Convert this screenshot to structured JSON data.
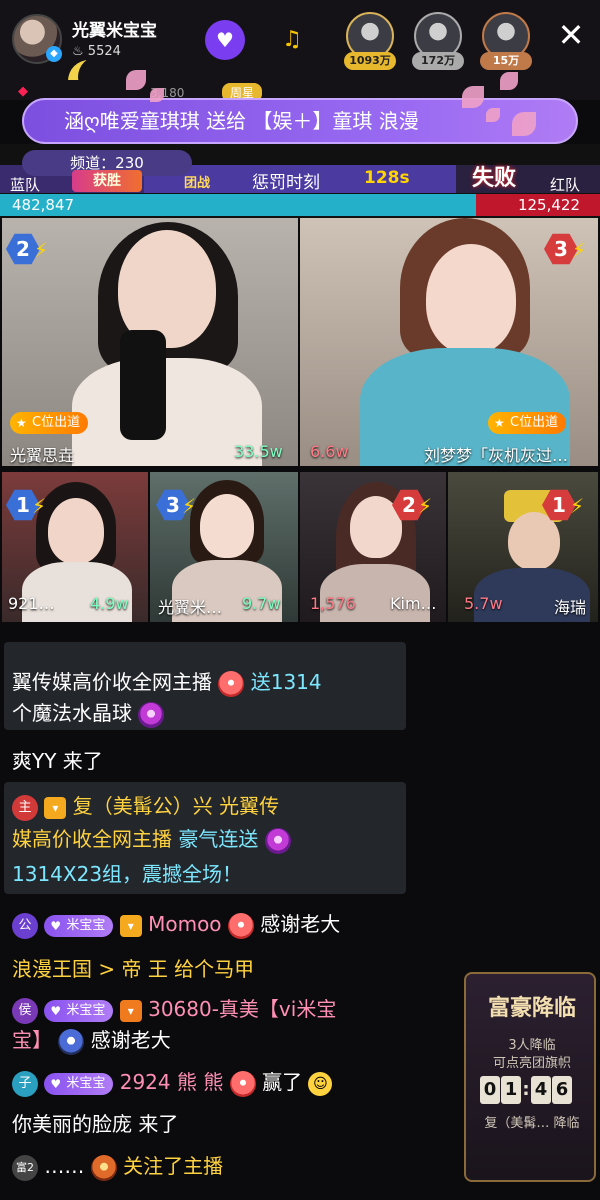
{
  "header": {
    "host_name": "光翼米宝宝",
    "host_fans": "5524",
    "viewers": [
      {
        "count": "1093万"
      },
      {
        "count": "172万"
      },
      {
        "count": "15万"
      }
    ]
  },
  "info": {
    "rank_value": "3,180",
    "tag": "周星"
  },
  "gift_banner": {
    "text": "涵ღ唯爱童琪琪 送给 【娱＋】童琪 浪漫"
  },
  "channel": "频道：230",
  "pk": {
    "blue_label": "蓝队",
    "red_label": "红队",
    "win_badge": "获胜",
    "fail_badge": "失败",
    "punish_icon": "团战",
    "punish_text": "惩罚时刻",
    "timer": "128s",
    "blue_score": "482,847",
    "red_score": "125,422",
    "blue_score_num": 482847,
    "red_score_num": 125422
  },
  "tiles_top": [
    {
      "rank": "2",
      "cpos": "C位出道",
      "name": "光翼思垚",
      "score": "33.5w"
    },
    {
      "rank": "3",
      "cpos": "C位出道",
      "name": "刘梦梦「灰机灰过…",
      "score": "6.6w"
    }
  ],
  "tiles_bottom": [
    {
      "rank": "1",
      "name": "921…",
      "score": "4.9w"
    },
    {
      "rank": "3",
      "name": "光翼米…",
      "score": "9.7w"
    },
    {
      "rank": "2",
      "name": "Kim…",
      "score": "1,576"
    },
    {
      "rank": "1",
      "name": "海瑞",
      "score": "5.7w"
    }
  ],
  "chat": {
    "msg1_line1": "翼传媒高价收全网主播",
    "msg1_send": "送1314",
    "msg1_line2": "个魔法水晶球",
    "msg2": "爽YY 来了",
    "msg3_user": "复（美髯公）兴 光翼传",
    "msg3_line2a": "媒高价收全网主播",
    "msg3_action": "豪气连送",
    "msg3_line3": "1314X23组，震撼全场！",
    "msg4_level": "公",
    "msg4_vip": "米宝宝",
    "msg4_user": "Momoo",
    "msg4_text": "感谢老大",
    "msg5_text": "浪漫王国 >  帝 王 给个马甲",
    "msg6_level": "侯",
    "msg6_vip": "米宝宝",
    "msg6_user_a": "30680-真美【vi米宝",
    "msg6_user_b": "宝】",
    "msg6_text": "感谢老大",
    "msg7_level": "子",
    "msg7_vip": "米宝宝",
    "msg7_user": "2924 熊 熊",
    "msg7_text": "赢了",
    "msg8": "你美丽的脸庞 来了",
    "msg9_level": "富2",
    "msg9_user": "……",
    "msg9_text": "关注了主播",
    "msg_rank_prefix": "主"
  },
  "rich_panel": {
    "title": "富豪降临",
    "line1": "3人降临",
    "line2": "可点亮团旗帜",
    "timer": [
      "0",
      "1",
      ":",
      "4",
      "6"
    ],
    "footer": "复（美髯… 降临"
  },
  "colors": {
    "accent_purple": "#7a3ef0",
    "blue_team": "#23b0c8",
    "red_team": "#c0172d",
    "gold": "#ffd23f"
  }
}
